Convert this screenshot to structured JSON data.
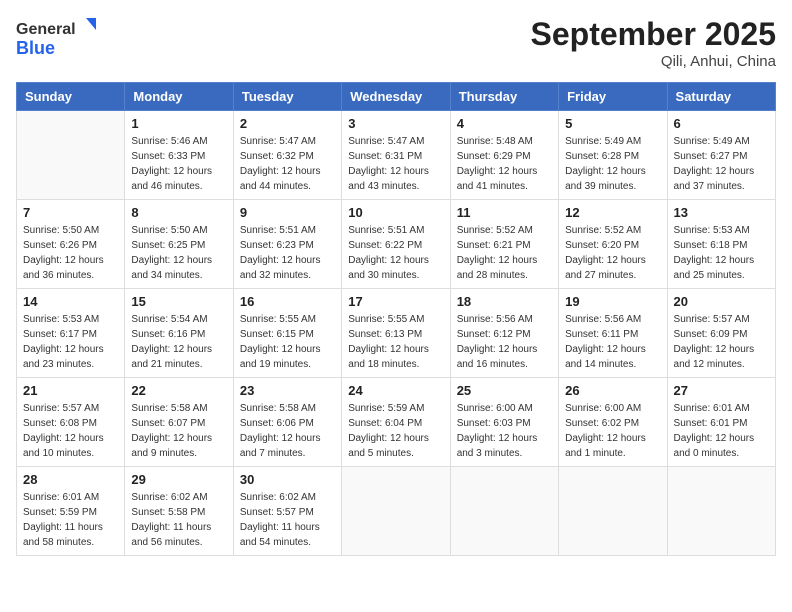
{
  "header": {
    "logo_general": "General",
    "logo_blue": "Blue",
    "month_title": "September 2025",
    "location": "Qili, Anhui, China"
  },
  "weekdays": [
    "Sunday",
    "Monday",
    "Tuesday",
    "Wednesday",
    "Thursday",
    "Friday",
    "Saturday"
  ],
  "weeks": [
    [
      {
        "day": "",
        "info": ""
      },
      {
        "day": "1",
        "info": "Sunrise: 5:46 AM\nSunset: 6:33 PM\nDaylight: 12 hours\nand 46 minutes."
      },
      {
        "day": "2",
        "info": "Sunrise: 5:47 AM\nSunset: 6:32 PM\nDaylight: 12 hours\nand 44 minutes."
      },
      {
        "day": "3",
        "info": "Sunrise: 5:47 AM\nSunset: 6:31 PM\nDaylight: 12 hours\nand 43 minutes."
      },
      {
        "day": "4",
        "info": "Sunrise: 5:48 AM\nSunset: 6:29 PM\nDaylight: 12 hours\nand 41 minutes."
      },
      {
        "day": "5",
        "info": "Sunrise: 5:49 AM\nSunset: 6:28 PM\nDaylight: 12 hours\nand 39 minutes."
      },
      {
        "day": "6",
        "info": "Sunrise: 5:49 AM\nSunset: 6:27 PM\nDaylight: 12 hours\nand 37 minutes."
      }
    ],
    [
      {
        "day": "7",
        "info": "Sunrise: 5:50 AM\nSunset: 6:26 PM\nDaylight: 12 hours\nand 36 minutes."
      },
      {
        "day": "8",
        "info": "Sunrise: 5:50 AM\nSunset: 6:25 PM\nDaylight: 12 hours\nand 34 minutes."
      },
      {
        "day": "9",
        "info": "Sunrise: 5:51 AM\nSunset: 6:23 PM\nDaylight: 12 hours\nand 32 minutes."
      },
      {
        "day": "10",
        "info": "Sunrise: 5:51 AM\nSunset: 6:22 PM\nDaylight: 12 hours\nand 30 minutes."
      },
      {
        "day": "11",
        "info": "Sunrise: 5:52 AM\nSunset: 6:21 PM\nDaylight: 12 hours\nand 28 minutes."
      },
      {
        "day": "12",
        "info": "Sunrise: 5:52 AM\nSunset: 6:20 PM\nDaylight: 12 hours\nand 27 minutes."
      },
      {
        "day": "13",
        "info": "Sunrise: 5:53 AM\nSunset: 6:18 PM\nDaylight: 12 hours\nand 25 minutes."
      }
    ],
    [
      {
        "day": "14",
        "info": "Sunrise: 5:53 AM\nSunset: 6:17 PM\nDaylight: 12 hours\nand 23 minutes."
      },
      {
        "day": "15",
        "info": "Sunrise: 5:54 AM\nSunset: 6:16 PM\nDaylight: 12 hours\nand 21 minutes."
      },
      {
        "day": "16",
        "info": "Sunrise: 5:55 AM\nSunset: 6:15 PM\nDaylight: 12 hours\nand 19 minutes."
      },
      {
        "day": "17",
        "info": "Sunrise: 5:55 AM\nSunset: 6:13 PM\nDaylight: 12 hours\nand 18 minutes."
      },
      {
        "day": "18",
        "info": "Sunrise: 5:56 AM\nSunset: 6:12 PM\nDaylight: 12 hours\nand 16 minutes."
      },
      {
        "day": "19",
        "info": "Sunrise: 5:56 AM\nSunset: 6:11 PM\nDaylight: 12 hours\nand 14 minutes."
      },
      {
        "day": "20",
        "info": "Sunrise: 5:57 AM\nSunset: 6:09 PM\nDaylight: 12 hours\nand 12 minutes."
      }
    ],
    [
      {
        "day": "21",
        "info": "Sunrise: 5:57 AM\nSunset: 6:08 PM\nDaylight: 12 hours\nand 10 minutes."
      },
      {
        "day": "22",
        "info": "Sunrise: 5:58 AM\nSunset: 6:07 PM\nDaylight: 12 hours\nand 9 minutes."
      },
      {
        "day": "23",
        "info": "Sunrise: 5:58 AM\nSunset: 6:06 PM\nDaylight: 12 hours\nand 7 minutes."
      },
      {
        "day": "24",
        "info": "Sunrise: 5:59 AM\nSunset: 6:04 PM\nDaylight: 12 hours\nand 5 minutes."
      },
      {
        "day": "25",
        "info": "Sunrise: 6:00 AM\nSunset: 6:03 PM\nDaylight: 12 hours\nand 3 minutes."
      },
      {
        "day": "26",
        "info": "Sunrise: 6:00 AM\nSunset: 6:02 PM\nDaylight: 12 hours\nand 1 minute."
      },
      {
        "day": "27",
        "info": "Sunrise: 6:01 AM\nSunset: 6:01 PM\nDaylight: 12 hours\nand 0 minutes."
      }
    ],
    [
      {
        "day": "28",
        "info": "Sunrise: 6:01 AM\nSunset: 5:59 PM\nDaylight: 11 hours\nand 58 minutes."
      },
      {
        "day": "29",
        "info": "Sunrise: 6:02 AM\nSunset: 5:58 PM\nDaylight: 11 hours\nand 56 minutes."
      },
      {
        "day": "30",
        "info": "Sunrise: 6:02 AM\nSunset: 5:57 PM\nDaylight: 11 hours\nand 54 minutes."
      },
      {
        "day": "",
        "info": ""
      },
      {
        "day": "",
        "info": ""
      },
      {
        "day": "",
        "info": ""
      },
      {
        "day": "",
        "info": ""
      }
    ]
  ]
}
